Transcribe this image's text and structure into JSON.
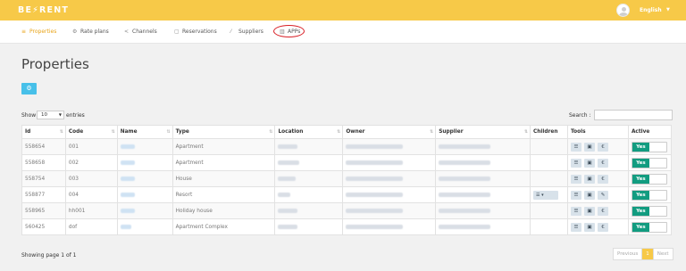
{
  "header": {
    "logo": "BE⚡RENT",
    "language": "English"
  },
  "nav": [
    {
      "label": "Properties",
      "icon": "≡",
      "icon_name": "list-icon"
    },
    {
      "label": "Rate plans",
      "icon": "⚙",
      "icon_name": "settings-icon"
    },
    {
      "label": "Channels",
      "icon": "<",
      "icon_name": "share-icon"
    },
    {
      "label": "Reservations",
      "icon": "▢",
      "icon_name": "calendar-icon"
    },
    {
      "label": "Suppliers",
      "icon": "⁄",
      "icon_name": "tools-icon"
    },
    {
      "label": "APPs",
      "icon": "▥",
      "icon_name": "apps-icon"
    }
  ],
  "page": {
    "title": "Properties",
    "add_icon": "⚙"
  },
  "controls": {
    "show_label": "Show",
    "entries_value": "10",
    "entries_label": "entries",
    "search_label": "Search :"
  },
  "table": {
    "columns": [
      "Id",
      "Code",
      "Name",
      "Type",
      "Location",
      "Owner",
      "Supplier",
      "Children",
      "Tools",
      "Active"
    ],
    "rows": [
      {
        "id": "558654",
        "code": "001",
        "type": "Apartment",
        "children": "",
        "active": "Yes"
      },
      {
        "id": "558658",
        "code": "002",
        "type": "Apartment",
        "children": "",
        "active": "Yes"
      },
      {
        "id": "558754",
        "code": "003",
        "type": "House",
        "children": "",
        "active": "Yes"
      },
      {
        "id": "558877",
        "code": "004",
        "type": "Resort",
        "children": "☰ ▾",
        "active": "Yes"
      },
      {
        "id": "558965",
        "code": "hh001",
        "type": "Holiday house",
        "children": "",
        "active": "Yes"
      },
      {
        "id": "560425",
        "code": "dof",
        "type": "Apartment Complex",
        "children": "",
        "active": "Yes"
      }
    ],
    "tool_icons": [
      "☰",
      "▣",
      "€"
    ],
    "tool_icons_row4": [
      "☰",
      "▣",
      "✎"
    ]
  },
  "footer": {
    "showing": "Showing page 1 of 1",
    "prev": "Previous",
    "page": "1",
    "next": "Next"
  },
  "colors": {
    "brand": "#f7c948",
    "accent_blue": "#47c0e9",
    "active_green": "#129c80",
    "apps_highlight": "#d81f26"
  }
}
